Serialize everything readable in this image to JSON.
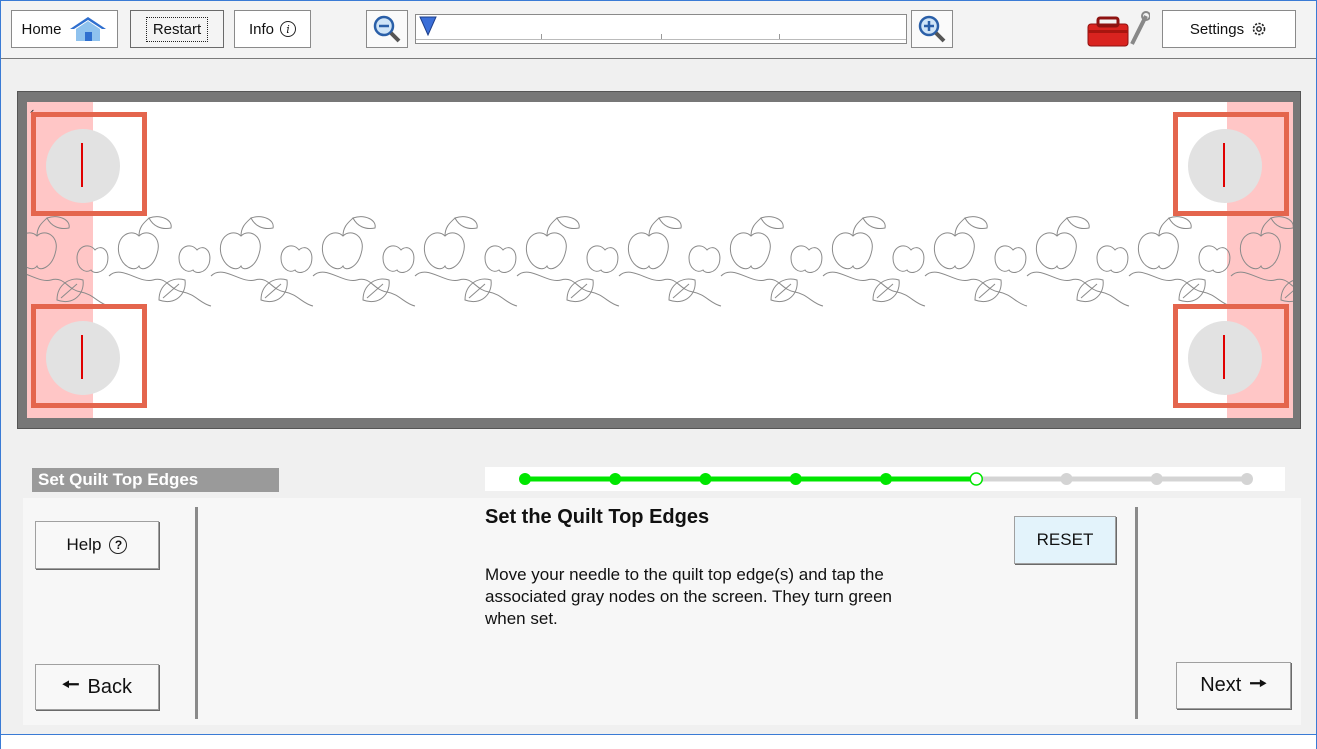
{
  "toolbar": {
    "home_label": "Home",
    "restart_label": "Restart",
    "info_label": "Info",
    "settings_label": "Settings",
    "icons": [
      "house-icon",
      "info-icon",
      "zoom-out-icon",
      "zoom-in-icon",
      "toolbox-icon",
      "gear-icon"
    ]
  },
  "step": {
    "title": "Set Quilt Top Edges",
    "total_steps": 9,
    "completed_steps": 5,
    "current_step": 6,
    "complete_color": "#00e600",
    "pending_color": "#d4d4d4"
  },
  "panel": {
    "heading": "Set the Quilt Top Edges",
    "instructions": "Move your needle to the quilt top edge(s) and tap the associated gray nodes on the screen. They turn green when set.",
    "help_label": "Help",
    "reset_label": "RESET",
    "back_label": "Back",
    "next_label": "Next"
  },
  "colors": {
    "edge_marker": "#e4654d",
    "edge_zone": "#ffc6c6",
    "node_line": "#e00000",
    "reset_bg": "#e3f3fb"
  }
}
